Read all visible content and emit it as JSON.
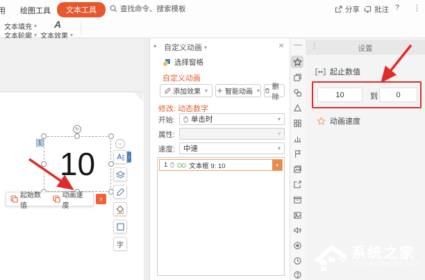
{
  "colors": {
    "accent_orange": "#e7572e",
    "orange_text": "#e0612e",
    "annotation_red": "#e02b2b",
    "selection_blue": "#4a7ebb",
    "list_item_orange": "#e78b4e",
    "badge_blue": "#b8cce4"
  },
  "topbar": {
    "tab_partial": "用",
    "tab_draw": "绘图工具",
    "tab_text": "文本工具",
    "search_placeholder": "查找命令、搜索模板",
    "share": "分享",
    "comment": "批注",
    "help": "?",
    "more": "⋮"
  },
  "ribbon": {
    "text_fill": "文本填充",
    "text_outline": "文本轮廓",
    "text_effect": "文本效果",
    "effect_glyph": "A"
  },
  "canvas": {
    "textbox_value": "10",
    "anim_badge": "1",
    "rotate_glyph": "↻",
    "quick_buttons": [
      {
        "label": "起始数值"
      },
      {
        "label": "动画速度"
      }
    ],
    "expand_glyph": "›",
    "collapse_glyph": "−",
    "float_text_glyph": "字",
    "float_tab_glyph": "›"
  },
  "anim_panel": {
    "title": "自定义动画",
    "select_pane": "选择窗格",
    "section_label": "自定义动画",
    "add_effect": "添加效果",
    "smart_anim": "智能动画",
    "delete_label": "删除",
    "modify_label": "修改: 动态数字",
    "start_label": "开始:",
    "start_value": "单击时",
    "prop_label": "属性:",
    "speed_label": "速度:",
    "speed_value": "中速",
    "item_index": "1",
    "item_text": "文本框 9: 10"
  },
  "settings": {
    "title": "设置",
    "handle": "⋮",
    "range_label": "起止数值",
    "from_value": "10",
    "to_label": "到",
    "to_value": "0",
    "speed_label": "动画速度"
  },
  "right_rail": {
    "icon_names": [
      "animation-pane",
      "layers",
      "shapes",
      "pyramid",
      "grid",
      "chart",
      "flag",
      "image-copy",
      "export",
      "archive",
      "picture",
      "audio",
      "target",
      "history",
      "help"
    ]
  },
  "watermark": {
    "name": "系统之家",
    "domain": "XITONGZHIJIA.NET"
  },
  "glyphs": {
    "caret": "▾",
    "close": "×",
    "collapse": "▴"
  }
}
